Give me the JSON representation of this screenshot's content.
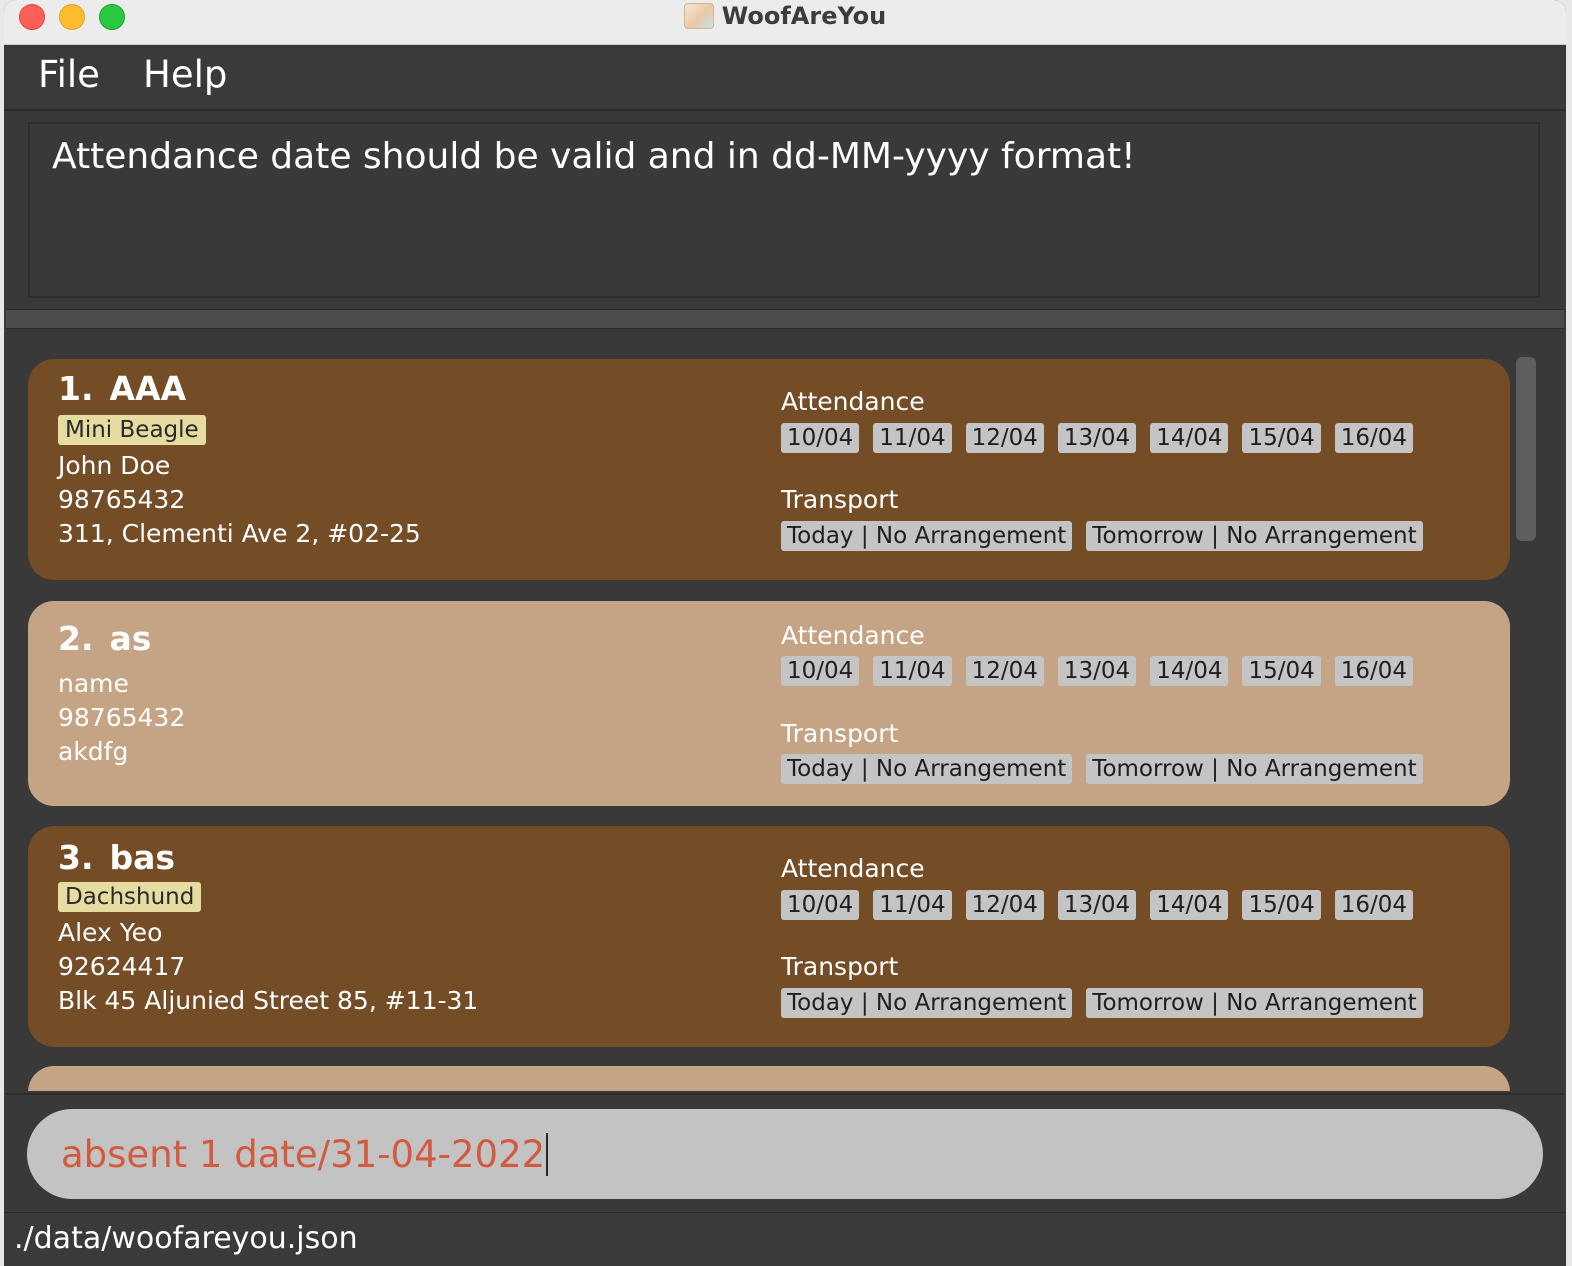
{
  "window": {
    "title": "WoofAreYou"
  },
  "menu": {
    "file": "File",
    "help": "Help"
  },
  "result": {
    "message": "Attendance date should be valid and in dd-MM-yyyy format!"
  },
  "labels": {
    "attendance": "Attendance",
    "transport": "Transport"
  },
  "pets": [
    {
      "index": "1.",
      "name": "AAA",
      "tag": "Mini Beagle",
      "owner": "John Doe",
      "phone": "98765432",
      "address": "311, Clementi Ave 2, #02-25",
      "attendance": [
        "10/04",
        "11/04",
        "12/04",
        "13/04",
        "14/04",
        "15/04",
        "16/04"
      ],
      "transport": [
        "Today | No Arrangement",
        "Tomorrow | No Arrangement"
      ],
      "theme": "dark"
    },
    {
      "index": "2.",
      "name": "as",
      "tag": "",
      "owner": "name",
      "phone": "98765432",
      "address": "akdfg",
      "attendance": [
        "10/04",
        "11/04",
        "12/04",
        "13/04",
        "14/04",
        "15/04",
        "16/04"
      ],
      "transport": [
        "Today | No Arrangement",
        "Tomorrow | No Arrangement"
      ],
      "theme": "light"
    },
    {
      "index": "3.",
      "name": "bas",
      "tag": "Dachshund",
      "owner": "Alex Yeo",
      "phone": "92624417",
      "address": "Blk 45 Aljunied Street 85, #11-31",
      "attendance": [
        "10/04",
        "11/04",
        "12/04",
        "13/04",
        "14/04",
        "15/04",
        "16/04"
      ],
      "transport": [
        "Today | No Arrangement",
        "Tomorrow | No Arrangement"
      ],
      "theme": "dark"
    }
  ],
  "command": {
    "value": "absent 1 date/31-04-2022"
  },
  "status": {
    "file_path": "./data/woofareyou.json"
  },
  "colors": {
    "card_dark": "#744c26",
    "card_light": "#c4a485",
    "tag_bg": "#e6dba1",
    "chip_bg": "#c4c4c4",
    "command_text": "#d25a3e"
  }
}
